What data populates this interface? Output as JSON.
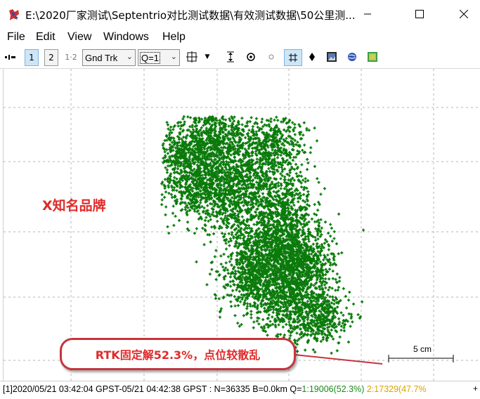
{
  "window": {
    "title": "E:\\2020厂家测试\\Septentrio对比测试数据\\有效测试数据\\50公里测..."
  },
  "menu": [
    "File",
    "Edit",
    "View",
    "Windows",
    "Help"
  ],
  "toolbar": {
    "plot1_label": "1",
    "plot2_label": "2",
    "plot12_label": "1·2",
    "plot_type": "Gnd Trk",
    "quality_filter": "Q=1"
  },
  "plot": {
    "brand_label": "X知名品牌",
    "callout_text": "RTK固定解52.3%，点位较散乱",
    "scale_label": "5 cm",
    "track_color": "#0a7a0a",
    "callout_color": "#c7343a"
  },
  "status": {
    "time_range": "[1]2020/05/21 03:42:04 GPST-05/21 04:42:38 GPST : N=36335 B=0.0km Q=",
    "q1_text": "1:19006(52.3%)",
    "q2_text": "2:17329(47.7%",
    "more_glyph": "+"
  }
}
